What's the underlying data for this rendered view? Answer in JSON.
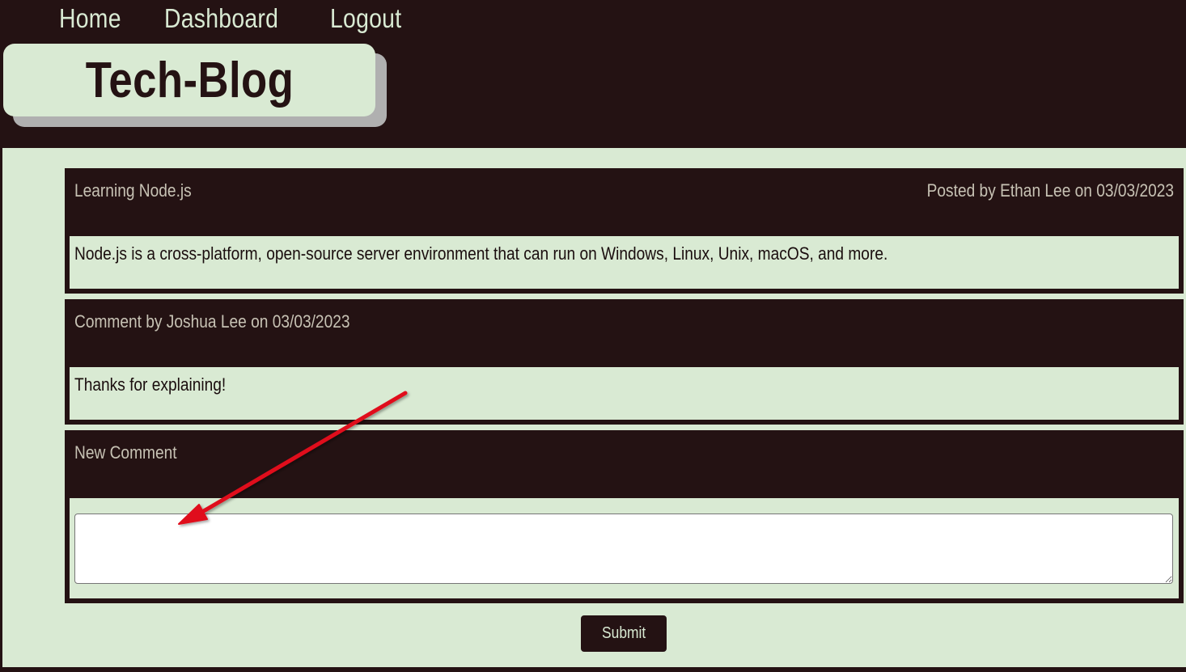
{
  "nav": {
    "home": "Home",
    "dashboard": "Dashboard",
    "logout": "Logout"
  },
  "logo": {
    "title": "Tech-Blog"
  },
  "post": {
    "title": "Learning Node.js",
    "meta": "Posted by Ethan Lee on 03/03/2023",
    "body": "Node.js is a cross-platform, open-source server environment that can run on Windows, Linux, Unix, macOS, and more."
  },
  "comments": [
    {
      "meta": "Comment by Joshua Lee on 03/03/2023",
      "body": "Thanks for explaining!"
    }
  ],
  "new_comment": {
    "heading": "New Comment",
    "value": ""
  },
  "submit_label": "Submit",
  "colors": {
    "dark": "#241213",
    "light": "#d9ead3",
    "annotation_arrow": "#e0101a"
  }
}
